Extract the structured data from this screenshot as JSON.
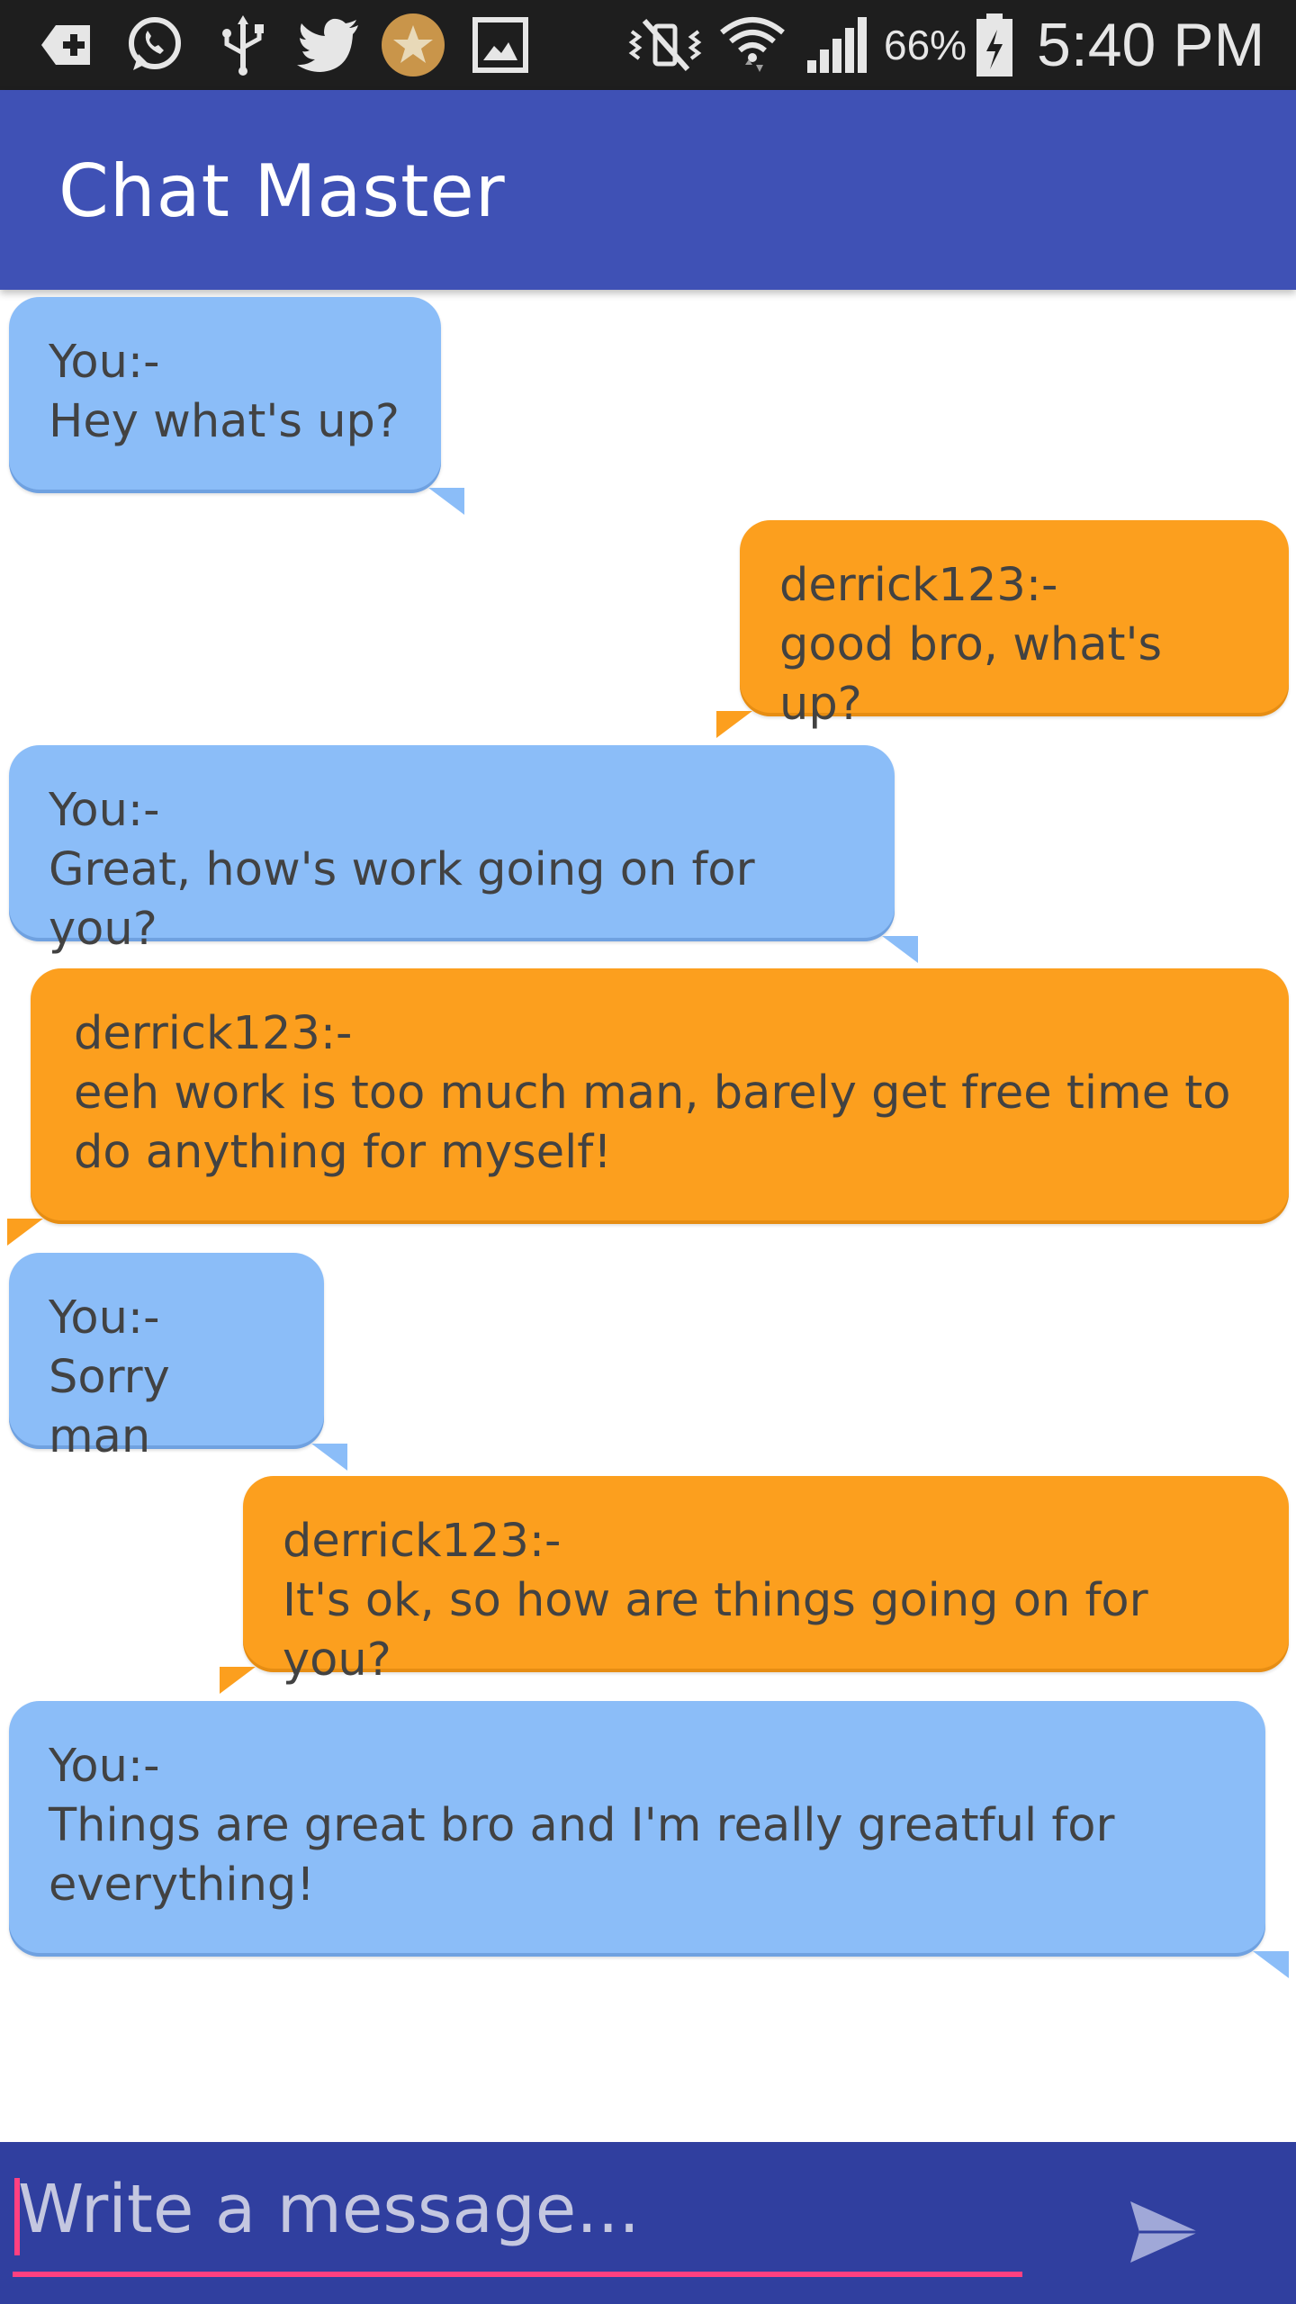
{
  "status_bar": {
    "battery": "66%",
    "time": "5:40 PM",
    "icons": [
      "add-box-icon",
      "whatsapp-icon",
      "usb-icon",
      "twitter-icon",
      "star-icon",
      "image-icon",
      "mute-icon",
      "wifi-icon",
      "signal-icon",
      "battery-icon"
    ]
  },
  "app_bar": {
    "title": "Chat Master"
  },
  "messages": [
    {
      "sender": "You:-",
      "text": "Hey what's up?"
    },
    {
      "sender": "derrick123:-",
      "text": "good bro, what's up?"
    },
    {
      "sender": "You:-",
      "text": "Great, how's work going on for you?"
    },
    {
      "sender": "derrick123:-",
      "text": "eeh work is too much man, barely get free time to do anything for myself!"
    },
    {
      "sender": "You:-",
      "text": "Sorry man"
    },
    {
      "sender": "derrick123:-",
      "text": "It's ok, so how are things going on for you?"
    },
    {
      "sender": "You:-",
      "text": "Things are great bro and I'm really greatful for everything!"
    }
  ],
  "composer": {
    "placeholder": "Write a message..."
  },
  "colors": {
    "app_bar": "#3f51b5",
    "composer": "#303f9f",
    "you_bubble": "#8bbdf8",
    "other_bubble": "#fc9f1e",
    "accent": "#ff4081"
  }
}
